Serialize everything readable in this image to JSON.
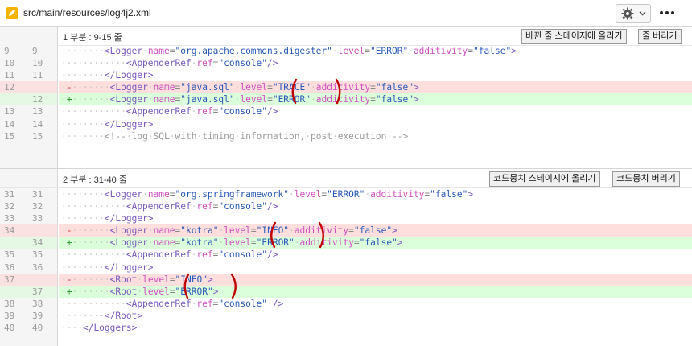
{
  "header": {
    "file_path": "src/main/resources/log4j2.xml"
  },
  "icons": {
    "file": "pencil-file-icon",
    "settings": "gear-icon",
    "dropdown": "chevron-down-icon",
    "more": "more-horizontal-icon"
  },
  "colors": {
    "deleted_bg": "#ffdede",
    "added_bg": "#dbffdb",
    "annotation": "#c00000"
  },
  "hunks": [
    {
      "title": "1 부분 : 9-15 줄",
      "stage_label": "바뀐 줄 스테이지에 올리기",
      "discard_label": "줄 버리기",
      "lines": [
        {
          "old": "9",
          "new": "9",
          "type": "ctx",
          "indent": 8,
          "code": "<Logger name=\"org.apache.commons.digester\" level=\"ERROR\" additivity=\"false\">"
        },
        {
          "old": "10",
          "new": "10",
          "type": "ctx",
          "indent": 12,
          "code": "<AppenderRef ref=\"console\"/>"
        },
        {
          "old": "11",
          "new": "11",
          "type": "ctx",
          "indent": 8,
          "code": "</Logger>"
        },
        {
          "old": "12",
          "new": "",
          "type": "del",
          "indent": 8,
          "code": "<Logger name=\"java.sql\" level=\"TRACE\" additivity=\"false\">"
        },
        {
          "old": "",
          "new": "12",
          "type": "add",
          "indent": 8,
          "code": "<Logger name=\"java.sql\" level=\"ERROR\" additivity=\"false\">"
        },
        {
          "old": "13",
          "new": "13",
          "type": "ctx",
          "indent": 12,
          "code": "<AppenderRef ref=\"console\"/>"
        },
        {
          "old": "14",
          "new": "14",
          "type": "ctx",
          "indent": 8,
          "code": "</Logger>"
        },
        {
          "old": "15",
          "new": "15",
          "type": "ctx",
          "indent": 8,
          "code": "<!-- log SQL with timing information, post execution -->"
        }
      ]
    },
    {
      "title": "2 부분 : 31-40 줄",
      "stage_label": "코드뭉치 스테이지에 올리기",
      "discard_label": "코드뭉치 버리기",
      "lines": [
        {
          "old": "31",
          "new": "31",
          "type": "ctx",
          "indent": 8,
          "code": "<Logger name=\"org.springframework\" level=\"ERROR\" additivity=\"false\">"
        },
        {
          "old": "32",
          "new": "32",
          "type": "ctx",
          "indent": 12,
          "code": "<AppenderRef ref=\"console\"/>"
        },
        {
          "old": "33",
          "new": "33",
          "type": "ctx",
          "indent": 8,
          "code": "</Logger>"
        },
        {
          "old": "34",
          "new": "",
          "type": "del",
          "indent": 8,
          "code": "<Logger name=\"kotra\" level=\"INFO\" additivity=\"false\">"
        },
        {
          "old": "",
          "new": "34",
          "type": "add",
          "indent": 8,
          "code": "<Logger name=\"kotra\" level=\"ERROR\" additivity=\"false\">"
        },
        {
          "old": "35",
          "new": "35",
          "type": "ctx",
          "indent": 12,
          "code": "<AppenderRef ref=\"console\"/>"
        },
        {
          "old": "36",
          "new": "36",
          "type": "ctx",
          "indent": 8,
          "code": "</Logger>"
        },
        {
          "old": "37",
          "new": "",
          "type": "del",
          "indent": 8,
          "code": "<Root level=\"INFO\">"
        },
        {
          "old": "",
          "new": "37",
          "type": "add",
          "indent": 8,
          "code": "<Root level=\"ERROR\">"
        },
        {
          "old": "38",
          "new": "38",
          "type": "ctx",
          "indent": 12,
          "code": "<AppenderRef ref=\"console\" />"
        },
        {
          "old": "39",
          "new": "39",
          "type": "ctx",
          "indent": 8,
          "code": "</Root>"
        },
        {
          "old": "40",
          "new": "40",
          "type": "ctx",
          "indent": 4,
          "code": "</Loggers>"
        }
      ]
    }
  ]
}
